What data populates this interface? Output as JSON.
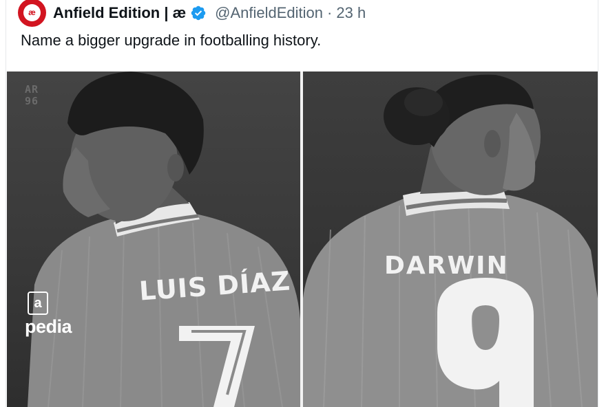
{
  "tweet": {
    "author_name": "Anfield Edition | æ",
    "avatar_text": "æ",
    "handle": "@AnfieldEdition",
    "separator": "·",
    "time": "23 h",
    "text": "Name a bigger upgrade in footballing history."
  },
  "media": {
    "watermark": "AR 96",
    "left_player": {
      "shirt_name": "LUIS DÍAZ",
      "shirt_number": "7",
      "sponsor": "pedia"
    },
    "right_player": {
      "shirt_name": "DARWIN",
      "shirt_number": "9"
    }
  },
  "colors": {
    "brand_red": "#d21420",
    "verified_blue": "#1d9bf0",
    "secondary_text": "#536471"
  }
}
